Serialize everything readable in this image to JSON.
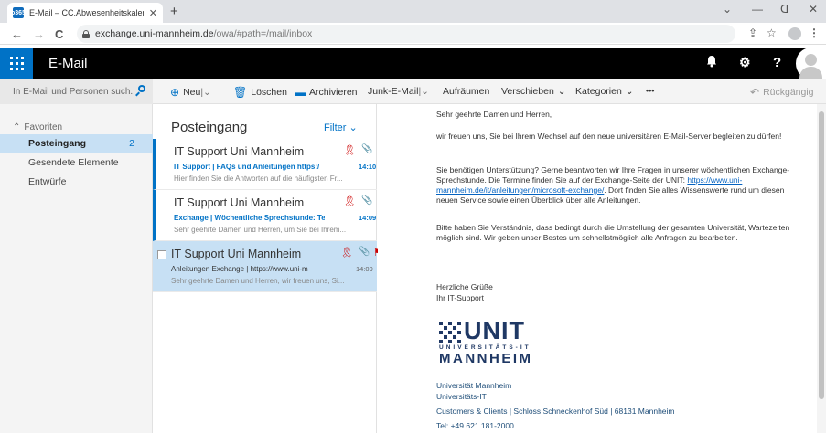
{
  "browser": {
    "tab_title": "E-Mail – CC.Abwesenheitskalender",
    "favicon_text": "o365",
    "tab_close": "✕",
    "new_tab": "+",
    "url_host": "exchange.uni-mannheim.de",
    "url_path": "/owa/#path=/mail/inbox",
    "back": "←",
    "forward": "→",
    "reload": "C",
    "minimize": "—",
    "restore": "ᗡ",
    "close": "✕",
    "tab_menu": "⌄",
    "icons": [
      "lock-icon",
      "share-icon",
      "bookmark-star-icon",
      "profile-icon",
      "menu-dots-icon"
    ]
  },
  "owa": {
    "app_name": "E-Mail",
    "bell": "🔔",
    "gear": "⚙",
    "help": "?"
  },
  "commandbar": {
    "search_placeholder": "In E-Mail und Personen such...",
    "new_label": "Neu",
    "new_caret": "|⌄",
    "delete_label": "Löschen",
    "archive_label": "Archivieren",
    "junk_label": "Junk-E-Mail",
    "junk_caret": "|⌄",
    "sweep_label": "Aufräumen",
    "move_label": "Verschieben",
    "move_caret": "⌄",
    "categories_label": "Kategorien",
    "categories_caret": "⌄",
    "more_label": "•••",
    "undo_label": "Rückgängig"
  },
  "nav": {
    "favorites_label": "Favoriten",
    "items": [
      {
        "label": "Posteingang",
        "count": "2"
      },
      {
        "label": "Gesendete Elemente"
      },
      {
        "label": "Entwürfe"
      }
    ]
  },
  "messagelist": {
    "title": "Posteingang",
    "filter_label": "Filter ⌄",
    "messages": [
      {
        "from": "IT Support Uni Mannheim",
        "subject": "IT Support | FAQs und Anleitungen https:/",
        "time": "14:10",
        "preview": "Hier finden Sie die Antworten auf die häufigsten Fr..."
      },
      {
        "from": "IT Support Uni Mannheim",
        "subject": "Exchange | Wöchentliche Sprechstunde: Te",
        "time": "14:09",
        "preview": "Sehr geehrte Damen und Herren, um Sie bei Ihrem..."
      },
      {
        "from": "IT Support Uni Mannheim",
        "subject": "Anleitungen Exchange | https://www.uni-m",
        "time": "14:09",
        "preview": "Sehr geehrte Damen und Herren, wir freuen uns, Si..."
      }
    ]
  },
  "reading": {
    "greeting": "Sehr geehrte Damen und Herren,",
    "p1": "wir freuen uns, Sie bei Ihrem Wechsel auf den neue universitären E-Mail-Server begleiten zu dürfen!",
    "p2_a": "Sie benötigen Unterstützung? Gerne beantworten wir Ihre Fragen in unserer wöchentlichen Exchange-Sprechstunde. Die Termine finden Sie auf der Exchange-Seite der UNIT: ",
    "p2_link": "https://www.uni-mannheim.de/it/anleitungen/microsoft-exchange/",
    "p2_b": ". Dort finden Sie alles Wissenswerte rund um diesen neuen Service sowie einen Überblick über alle Anleitungen.",
    "p3": "Bitte haben Sie Verständnis, dass bedingt durch die Umstellung der gesamten Universität, Wartezeiten möglich sind. Wir geben unser Bestes um schnellstmöglich alle Anfragen zu bearbeiten.",
    "closing": "Herzliche Grüße",
    "sign": "Ihr IT-Support",
    "logo_unit": "UNIT",
    "logo_sub": "UNIVERSITÄTS-IT",
    "logo_city": "MANNHEIM",
    "sig_line1": "Universität Mannheim",
    "sig_line2": "Universitäts-IT",
    "sig_line3": "Customers & Clients | Schloss Schneckenhof Süd | 68131 Mannheim",
    "sig_line4": "Tel: +49 621 181-2000"
  }
}
